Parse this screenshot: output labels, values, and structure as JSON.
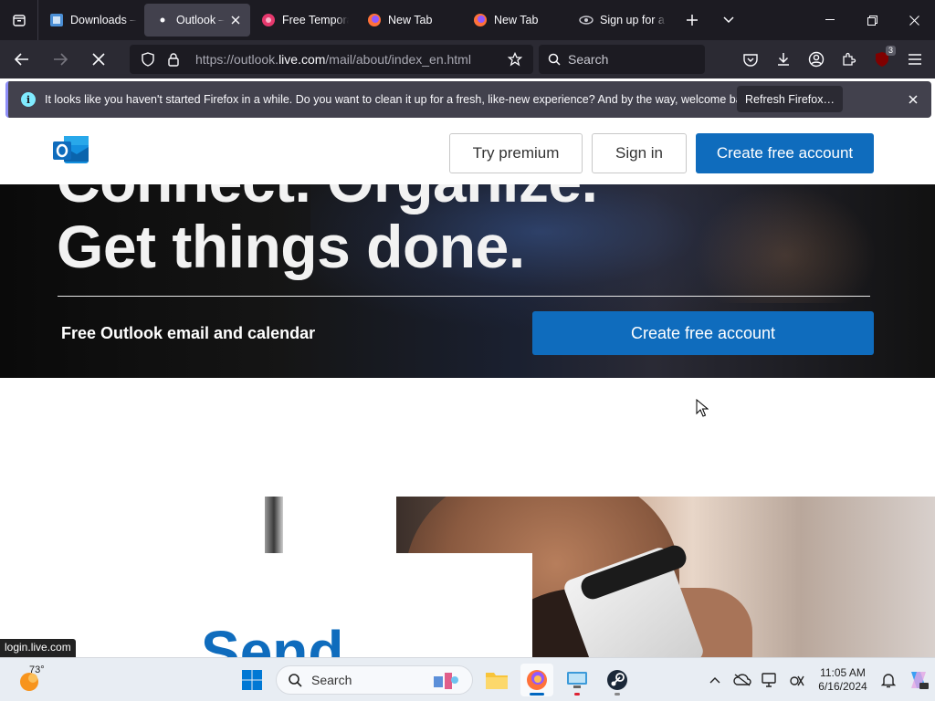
{
  "browser": {
    "tabs": [
      {
        "title": "Downloads – F",
        "icon": "downloads-favicon",
        "active": false
      },
      {
        "title": "Outlook – fr",
        "icon": "loading-dot",
        "active": true
      },
      {
        "title": "Free Temporar",
        "icon": "temp-mail-favicon",
        "active": false
      },
      {
        "title": "New Tab",
        "icon": "firefox-favicon",
        "active": false
      },
      {
        "title": "New Tab",
        "icon": "firefox-favicon",
        "active": false
      },
      {
        "title": "Sign up for a F",
        "icon": "signup-favicon",
        "active": false
      }
    ],
    "url_prefix": "https://outlook.",
    "url_domain": "live.com",
    "url_path": "/mail/about/index_en.html",
    "search_placeholder": "Search",
    "extensions_badge": "3"
  },
  "notification": {
    "message": "It looks like you haven't started Firefox in a while. Do you want to clean it up for a fresh, like-new experience? And by the way, welcome back!",
    "button_label": "Refresh Firefox…"
  },
  "site": {
    "try_premium": "Try premium",
    "sign_in": "Sign in",
    "create_account_header": "Create free account",
    "headline_top": "Connect. Organize.",
    "headline": "Get things done.",
    "subheading": "Free Outlook email and calendar",
    "create_account_hero": "Create free account",
    "partial_heading": "Send"
  },
  "status_bar": "login.live.com",
  "taskbar": {
    "weather_temp": "73°",
    "search_label": "Search",
    "time": "11:05 AM",
    "date": "6/16/2024"
  },
  "colors": {
    "brand_blue": "#0f6cbd",
    "firefox_dark": "#1c1b22"
  }
}
